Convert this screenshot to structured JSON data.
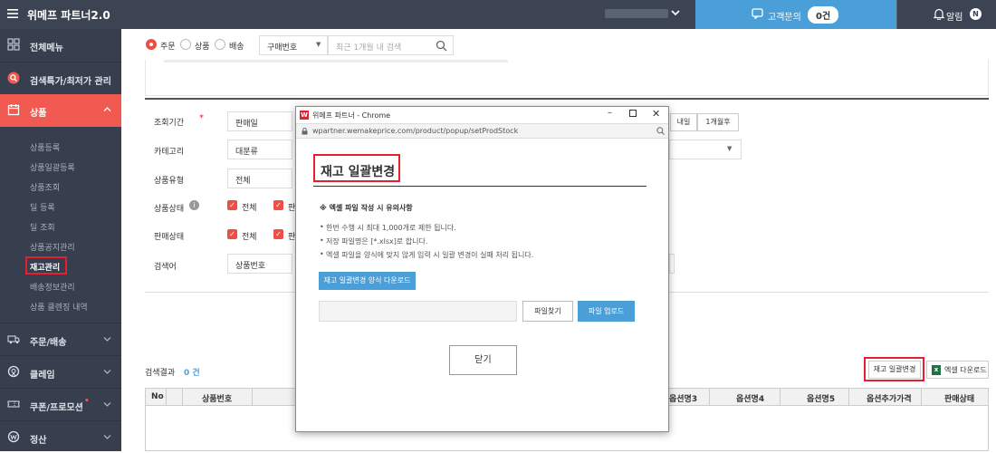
{
  "header": {
    "brand": "위메프 파트너2.0",
    "cs_label": "고객문의",
    "cs_count": "0건",
    "alarm_label": "알림",
    "alarm_badge": "N"
  },
  "sidebar": {
    "items": [
      {
        "label": "전체메뉴"
      },
      {
        "label": "검색특가/최저가 관리"
      },
      {
        "label": "상품"
      },
      {
        "label": "주문/배송"
      },
      {
        "label": "클레임"
      },
      {
        "label": "쿠폰/프로모션"
      },
      {
        "label": "정산"
      }
    ],
    "sub_items": [
      "상품등록",
      "상품일괄등록",
      "상품조회",
      "딜 등록",
      "딜 조회",
      "상품공지관리",
      "재고관리",
      "배송정보관리",
      "상품 클렌징 내역"
    ]
  },
  "search_bar": {
    "radio_order": "주문",
    "radio_product": "상품",
    "radio_delivery": "배송",
    "select_value": "구매번호",
    "placeholder": "최근 1개월 내 검색"
  },
  "form": {
    "period_label": "조회기간",
    "period_value": "판매일",
    "btn_tomorrow": "내일",
    "btn_month": "1개월후",
    "category_label": "카테고리",
    "category_value": "대분류",
    "type_label": "상품유형",
    "type_value": "전체",
    "status_label": "상품상태",
    "status_all": "전체",
    "status_partial": "판",
    "sale_label": "판매상태",
    "sale_all": "전체",
    "sale_partial": "판",
    "keyword_label": "검색어",
    "keyword_value": "상품번호"
  },
  "results": {
    "label": "검색결과",
    "count": "0 건",
    "bulk_btn": "재고 일괄변경",
    "excel_btn": "엑셀 다운로드"
  },
  "table": {
    "col_no": "No",
    "col_prodno": "상품번호",
    "col_opt3": "옵션명3",
    "col_opt4": "옵션명4",
    "col_opt5": "옵션명5",
    "col_optprice": "옵션추가가격",
    "col_sale": "판매상태"
  },
  "popup": {
    "window_title": "위메프 파트너 - Chrome",
    "url": "wpartner.wemakeprice.com/product/popup/setProdStock",
    "heading": "재고 일괄변경",
    "notice_title": "※ 엑셀 파일 작성 시 유의사항",
    "notes": [
      "한번 수행 시 최대 1,000개로 제한 됩니다.",
      "저장 파일명은 [*.xlsx]로 합니다.",
      "엑셀 파일을 양식에 맞지 않게 입력 시 일괄 변경이 실패 처리 됩니다."
    ],
    "download_btn": "재고 일괄변경 양식 다운로드",
    "find_btn": "파일찾기",
    "upload_btn": "파일 업로드",
    "close_btn": "닫기"
  },
  "colors": {
    "topbar": "#3c4454",
    "sidebar": "#373f4e",
    "accent_blue": "#4a9fd9",
    "active_red": "#f05a51",
    "highlight_red": "#e5202e"
  }
}
